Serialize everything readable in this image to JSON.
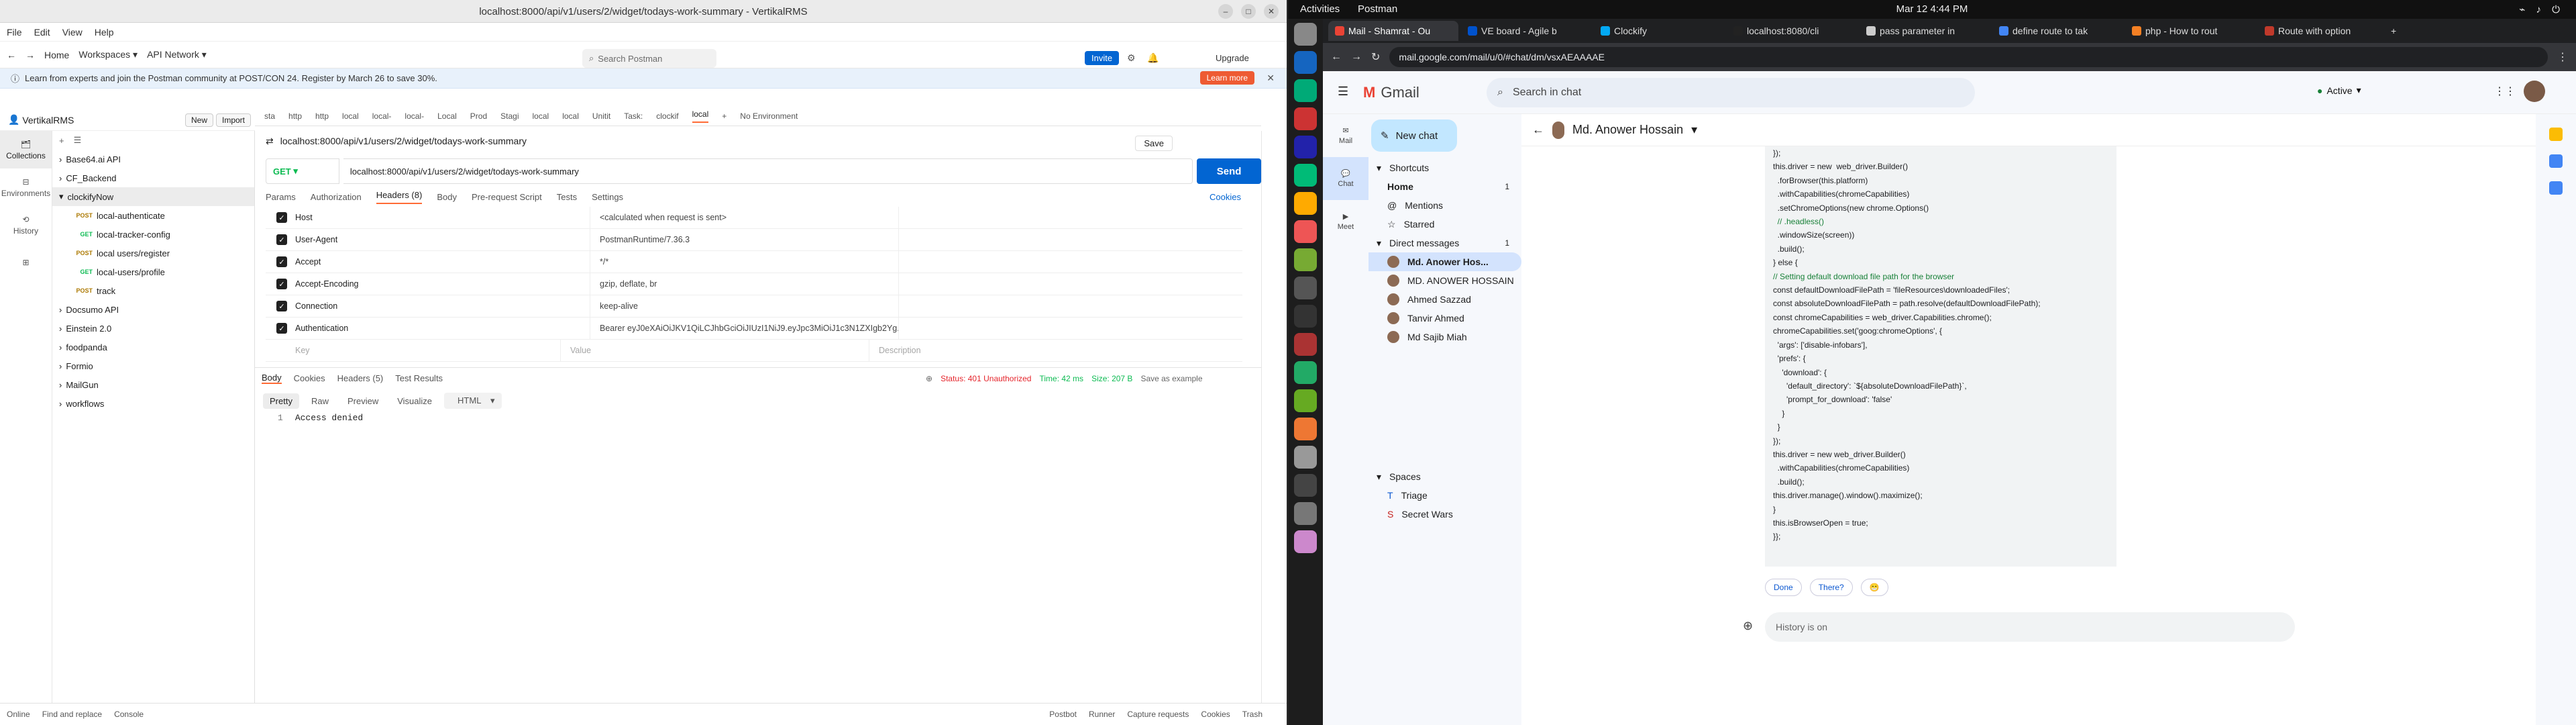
{
  "postman": {
    "window_title": "localhost:8000/api/v1/users/2/widget/todays-work-summary - VertikalRMS",
    "menu": [
      "File",
      "Edit",
      "View",
      "Help"
    ],
    "nav": {
      "home": "Home",
      "workspaces": "Workspaces",
      "api_network": "API Network",
      "search": "Search Postman",
      "invite": "Invite",
      "upgrade": "Upgrade"
    },
    "banner": {
      "text": "Learn from experts and join the Postman community at POST/CON 24. Register by March 26 to save 30%.",
      "button": "Learn more"
    },
    "workspace": {
      "name": "VertikalRMS",
      "new": "New",
      "import": "Import"
    },
    "rail": [
      "Collections",
      "Environments",
      "History"
    ],
    "tree": [
      {
        "label": "Base64.ai API",
        "method": "",
        "level": 0
      },
      {
        "label": "CF_Backend",
        "method": "",
        "level": 0
      },
      {
        "label": "clockifyNow",
        "method": "",
        "level": 0
      },
      {
        "label": "local-authenticate",
        "method": "POST",
        "level": 1
      },
      {
        "label": "local-tracker-config",
        "method": "GET",
        "level": 1
      },
      {
        "label": "local users/register",
        "method": "POST",
        "level": 1
      },
      {
        "label": "local-users/profile",
        "method": "GET",
        "level": 1
      },
      {
        "label": "track",
        "method": "POST",
        "level": 1
      },
      {
        "label": "Docsumo API",
        "method": "",
        "level": 0
      },
      {
        "label": "Einstein 2.0",
        "method": "",
        "level": 0
      },
      {
        "label": "foodpanda",
        "method": "",
        "level": 0
      },
      {
        "label": "Formio",
        "method": "",
        "level": 0
      },
      {
        "label": "MailGun",
        "method": "",
        "level": 0
      },
      {
        "label": "workflows",
        "method": "",
        "level": 0
      }
    ],
    "open_tabs": [
      "sta",
      "http",
      "http",
      "local",
      "local-",
      "local-",
      "Local",
      "Prod",
      "Stagi",
      "local",
      "local",
      "Unitit",
      "Task:",
      "clockif",
      "local"
    ],
    "env": "No Environment",
    "request_name": "localhost:8000/api/v1/users/2/widget/todays-work-summary",
    "save": "Save",
    "method": "GET",
    "url": "localhost:8000/api/v1/users/2/widget/todays-work-summary",
    "send": "Send",
    "req_tabs": [
      "Params",
      "Authorization",
      "Headers (8)",
      "Body",
      "Pre-request Script",
      "Tests",
      "Settings"
    ],
    "cookies": "Cookies",
    "headers": [
      {
        "key": "Host",
        "value": "<calculated when request is sent>"
      },
      {
        "key": "User-Agent",
        "value": "PostmanRuntime/7.36.3"
      },
      {
        "key": "Accept",
        "value": "*/*"
      },
      {
        "key": "Accept-Encoding",
        "value": "gzip, deflate, br"
      },
      {
        "key": "Connection",
        "value": "keep-alive"
      },
      {
        "key": "Authentication",
        "value": "Bearer eyJ0eXAiOiJKV1QiLCJhbGciOiJIUzI1NiJ9.eyJpc3MiOiJ1c3N1ZXIgb2Yg..."
      }
    ],
    "placeholder": {
      "key": "Key",
      "value": "Value",
      "desc": "Description"
    },
    "res_tabs": [
      "Body",
      "Cookies",
      "Headers (5)",
      "Test Results"
    ],
    "status": {
      "code": "Status: 401 Unauthorized",
      "time": "Time: 42 ms",
      "size": "Size: 207 B",
      "save": "Save as example"
    },
    "fmt": [
      "Pretty",
      "Raw",
      "Preview",
      "Visualize",
      "HTML"
    ],
    "line_no": "1",
    "body": "Access denied",
    "footer": [
      "Online",
      "Find and replace",
      "Console"
    ],
    "footer_right": [
      "Postbot",
      "Runner",
      "Capture requests",
      "Cookies",
      "Trash"
    ]
  },
  "desktop": {
    "activities": "Activities",
    "app": "Postman",
    "clock": "Mar 12  4:44 PM",
    "tabs": [
      "Mail - Shamrat - Ou",
      "VE board - Agile b",
      "Clockify",
      "localhost:8080/cli",
      "pass parameter in",
      "define route to tak",
      "php - How to rout",
      "Route with option"
    ],
    "url": "mail.google.com/mail/u/0/#chat/dm/vsxAEAAAAE",
    "gmail": "Gmail",
    "search": "Search in chat",
    "active": "Active",
    "rail": [
      "Mail",
      "Chat",
      "Meet"
    ],
    "new_chat": "New chat",
    "shortcuts": "Shortcuts",
    "home": "Home",
    "home_n": "1",
    "mentions": "Mentions",
    "starred": "Starred",
    "dm": "Direct messages",
    "dm_n": "1",
    "contacts": [
      "Md. Anower Hos...",
      "MD. ANOWER HOSSAIN",
      "Ahmed Sazzad",
      "Tanvir Ahmed",
      "Md Sajib Miah"
    ],
    "spaces": "Spaces",
    "space_items": [
      "Triage",
      "Secret Wars"
    ],
    "chat_title": "Md. Anower Hossain",
    "code": [
      "});",
      "",
      "this.driver = new  web_driver.Builder()",
      "  .forBrowser(this.platform)",
      "  .withCapabilities(chromeCapabilities)",
      "  .setChromeOptions(new chrome.Options()",
      "  // .headless()",
      "  .windowSize(screen))",
      "  .build();",
      "} else {",
      "// Setting default download file path for the browser",
      "const defaultDownloadFilePath = 'fileResources\\downloadedFiles';",
      "const absoluteDownloadFilePath = path.resolve(defaultDownloadFilePath);",
      "const chromeCapabilities = web_driver.Capabilities.chrome();",
      "chromeCapabilities.set('goog:chromeOptions', {",
      "  'args': ['disable-infobars'],",
      "  'prefs': {",
      "    'download': {",
      "      'default_directory': `${absoluteDownloadFilePath}`,",
      "      'prompt_for_download': 'false'",
      "    }",
      "  }",
      "});",
      "",
      "this.driver = new web_driver.Builder()",
      "  .withCapabilities(chromeCapabilities)",
      "  .build();",
      "",
      "this.driver.manage().window().maximize();",
      "}",
      "",
      "this.isBrowserOpen = true;",
      "}};"
    ],
    "reactions": [
      "Done",
      "There?",
      "😁"
    ],
    "compose": "History is on"
  }
}
